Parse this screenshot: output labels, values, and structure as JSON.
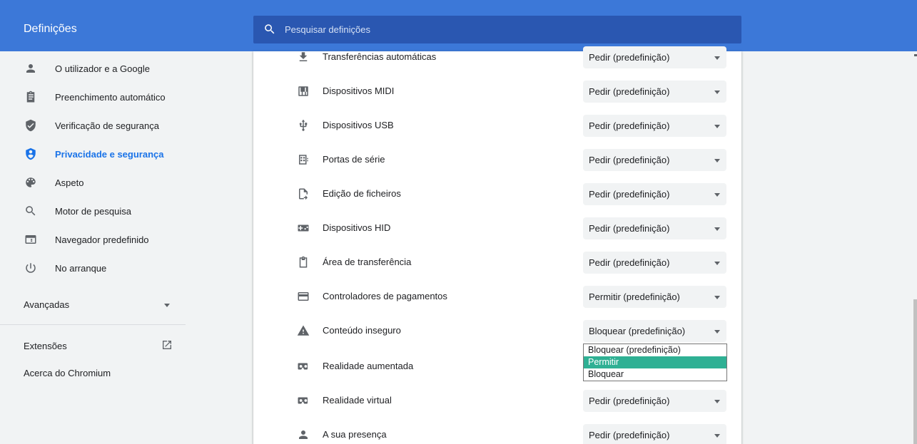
{
  "header": {
    "title": "Definições",
    "search_placeholder": "Pesquisar definições"
  },
  "sidebar": {
    "items": [
      {
        "label": "O utilizador e a Google",
        "icon": "person-icon"
      },
      {
        "label": "Preenchimento automático",
        "icon": "clipboard-icon"
      },
      {
        "label": "Verificação de segurança",
        "icon": "shield-check-icon"
      },
      {
        "label": "Privacidade e segurança",
        "icon": "privacy-shield-icon",
        "active": true
      },
      {
        "label": "Aspeto",
        "icon": "palette-icon"
      },
      {
        "label": "Motor de pesquisa",
        "icon": "search-icon"
      },
      {
        "label": "Navegador predefinido",
        "icon": "browser-window-icon"
      },
      {
        "label": "No arranque",
        "icon": "power-icon"
      }
    ],
    "advanced": "Avançadas",
    "extensions": "Extensões",
    "about": "Acerca do Chromium"
  },
  "permissions": [
    {
      "label": "Transferências automáticas",
      "value": "Pedir (predefinição)",
      "icon": "download-icon"
    },
    {
      "label": "Dispositivos MIDI",
      "value": "Pedir (predefinição)",
      "icon": "piano-icon"
    },
    {
      "label": "Dispositivos USB",
      "value": "Pedir (predefinição)",
      "icon": "usb-icon"
    },
    {
      "label": "Portas de série",
      "value": "Pedir (predefinição)",
      "icon": "serial-port-icon"
    },
    {
      "label": "Edição de ficheiros",
      "value": "Pedir (predefinição)",
      "icon": "file-edit-icon"
    },
    {
      "label": "Dispositivos HID",
      "value": "Pedir (predefinição)",
      "icon": "gamepad-icon"
    },
    {
      "label": "Área de transferência",
      "value": "Pedir (predefinição)",
      "icon": "clipboard-outline-icon"
    },
    {
      "label": "Controladores de pagamentos",
      "value": "Permitir (predefinição)",
      "icon": "credit-card-icon"
    },
    {
      "label": "Conteúdo inseguro",
      "value": "Bloquear (predefinição)",
      "icon": "warning-icon"
    },
    {
      "label": "Realidade aumentada",
      "value": "",
      "icon": "vr-headset-icon"
    },
    {
      "label": "Realidade virtual",
      "value": "Pedir (predefinição)",
      "icon": "vr-headset-icon"
    },
    {
      "label": "A sua presença",
      "value": "Pedir (predefinição)",
      "icon": "person-icon"
    }
  ],
  "dropdown": {
    "options": [
      "Bloquear (predefinição)",
      "Permitir",
      "Bloquear"
    ],
    "highlighted": "Permitir"
  },
  "colors": {
    "header_bg": "#3c78d8",
    "search_bg": "#2a57b1",
    "accent": "#1a73e8",
    "dropdown_highlight": "#2fb094"
  }
}
